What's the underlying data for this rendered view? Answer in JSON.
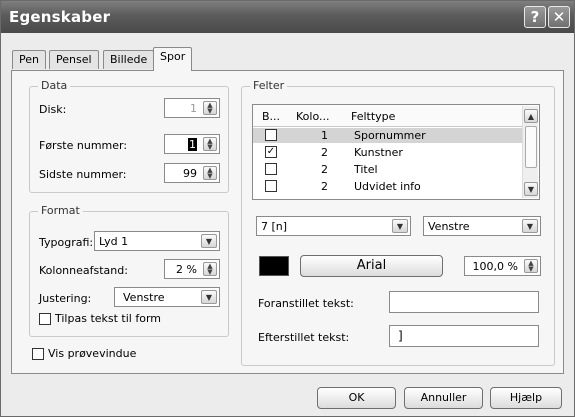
{
  "window": {
    "title": "Egenskaber"
  },
  "titlebar": {
    "help_glyph": "?",
    "close_glyph": "✕"
  },
  "tabs": [
    {
      "label": "Pen"
    },
    {
      "label": "Pensel"
    },
    {
      "label": "Billede"
    },
    {
      "label": "Spor",
      "active": true
    }
  ],
  "data_group": {
    "legend": "Data",
    "disk_label": "Disk:",
    "disk_value": "1",
    "first_label": "Første nummer:",
    "first_value": "1",
    "last_label": "Sidste nummer:",
    "last_value": "99"
  },
  "format_group": {
    "legend": "Format",
    "typography_label": "Typografi:",
    "typography_value": "Lyd 1",
    "spacing_label": "Kolonneafstand:",
    "spacing_value": "2 %",
    "align_label": "Justering:",
    "align_value": "Venstre",
    "fit_label": "Tilpas tekst til form"
  },
  "preview_label": "Vis prøvevindue",
  "fields_group": {
    "legend": "Felter",
    "columns": [
      "B...",
      "Kolo...",
      "Felttype"
    ],
    "rows": [
      {
        "checked": false,
        "col": "1",
        "type": "Spornummer",
        "selected": true
      },
      {
        "checked": true,
        "col": "2",
        "type": "Kunstner",
        "selected": false
      },
      {
        "checked": false,
        "col": "2",
        "type": "Titel",
        "selected": false
      },
      {
        "checked": false,
        "col": "2",
        "type": "Udvidet info",
        "selected": false
      }
    ],
    "format_select": "7 [n]",
    "align_select": "Venstre",
    "font_button": "Arial",
    "size_value": "100,0 %",
    "prefix_label": "Foranstillet tekst:",
    "prefix_value": "",
    "suffix_label": "Efterstillet tekst:",
    "suffix_value": "]"
  },
  "buttons": {
    "ok": "OK",
    "cancel": "Annuller",
    "help": "Hjælp"
  },
  "colors": {
    "title_bar": "#5b5b5b",
    "panel": "#f6f6f6",
    "swatch": "#000000"
  }
}
